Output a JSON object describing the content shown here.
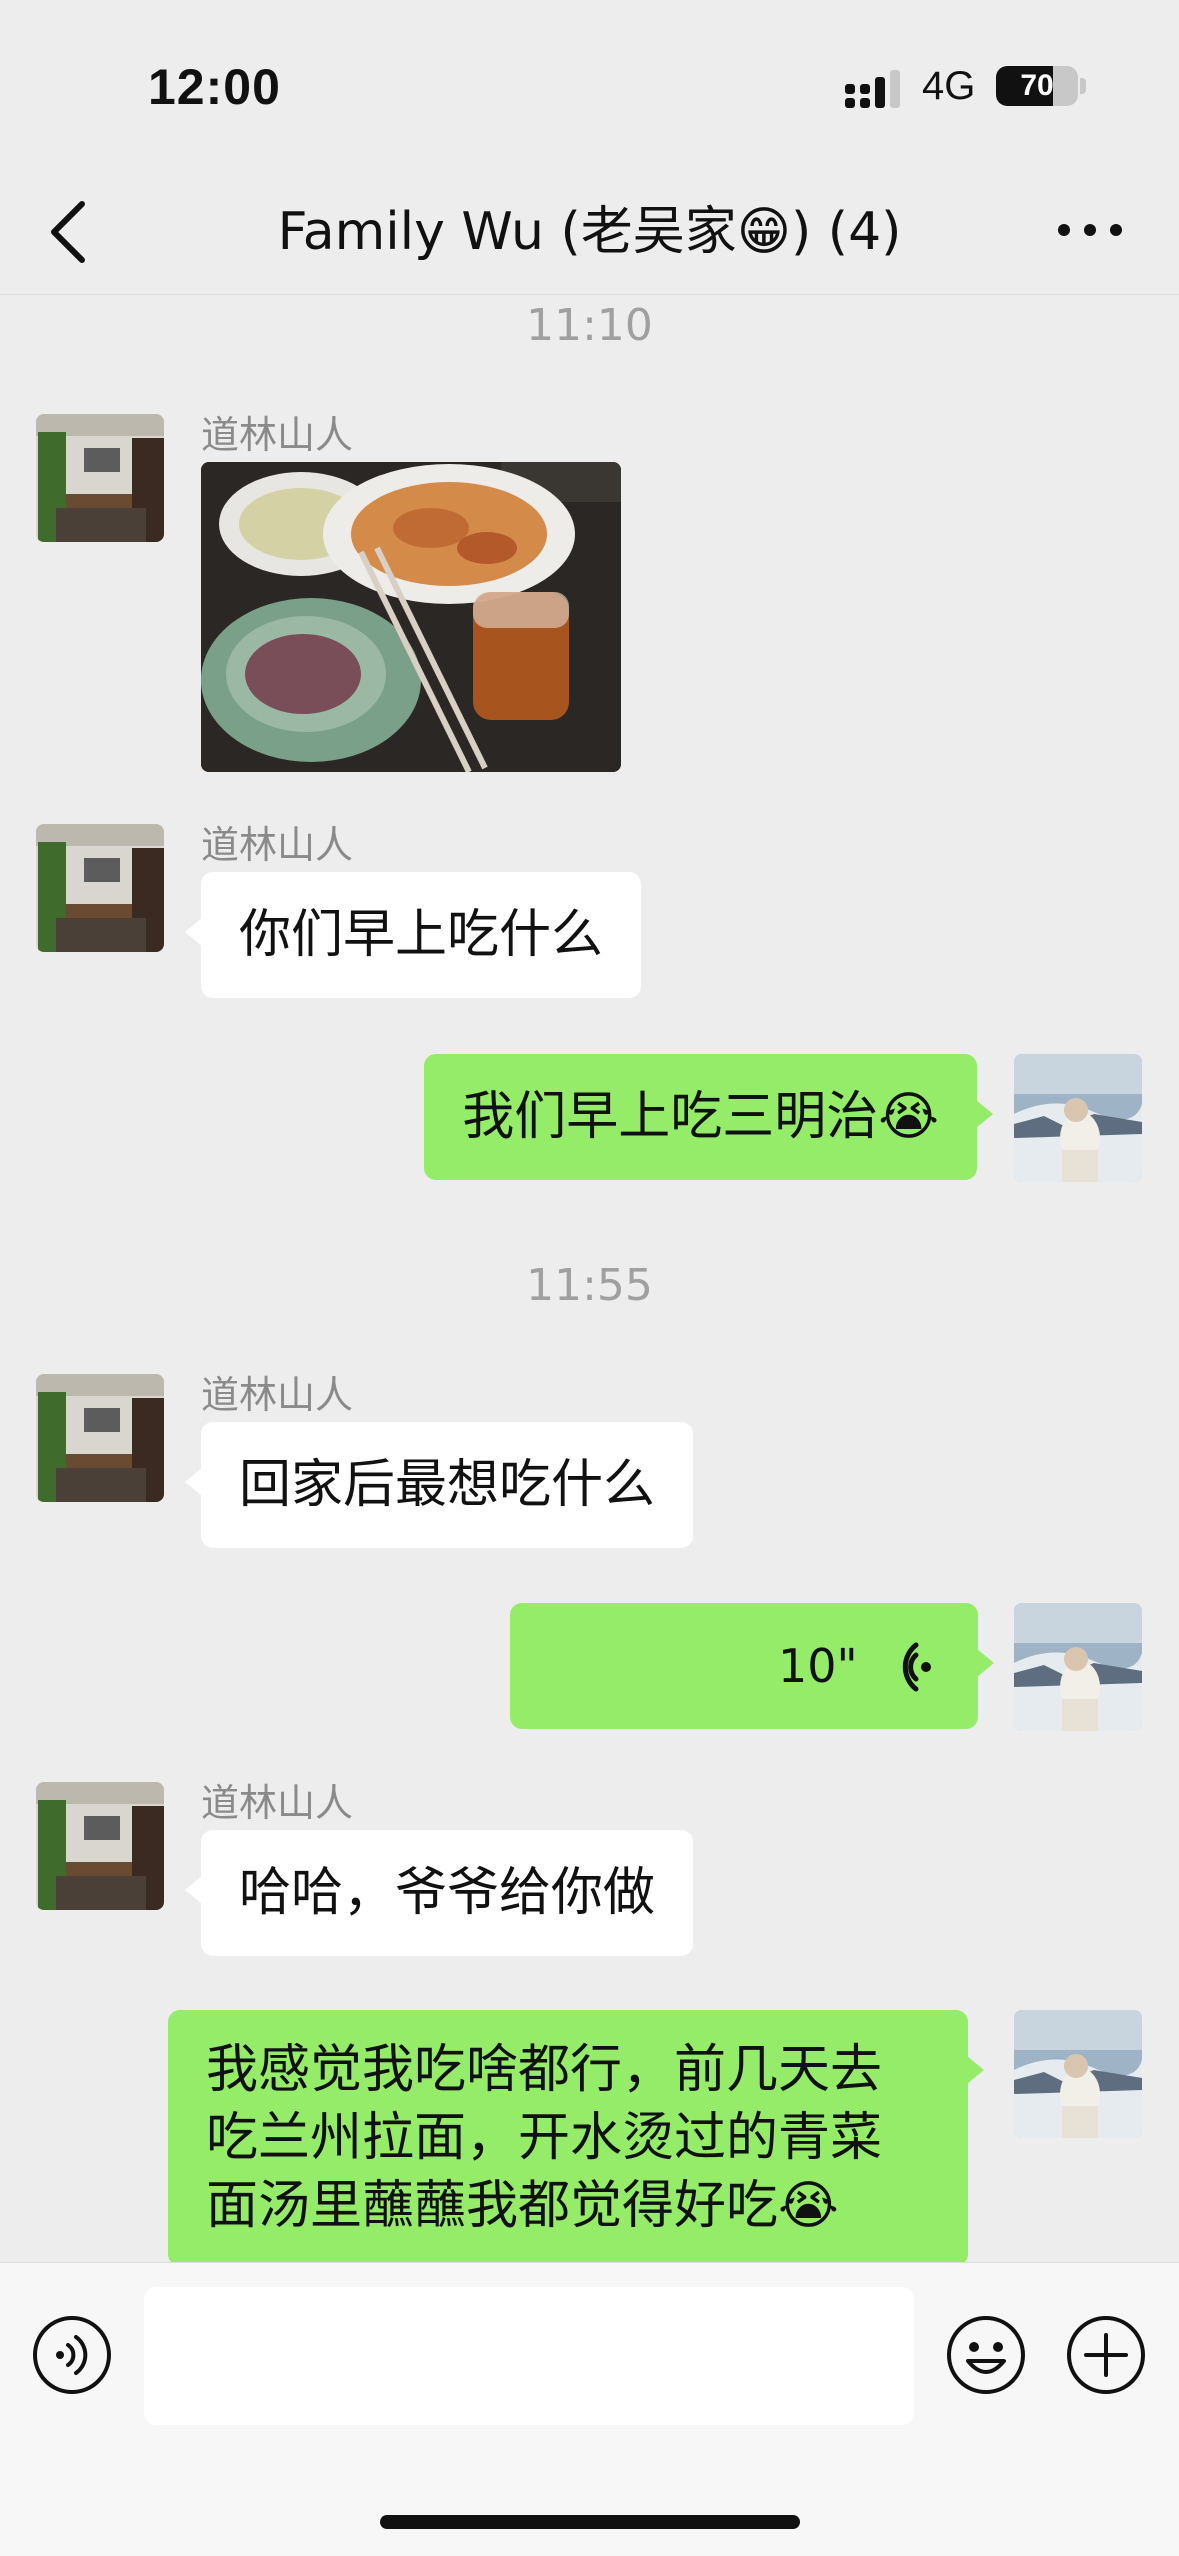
{
  "status_bar": {
    "time": "12:00",
    "network": "4G",
    "battery": "70"
  },
  "header": {
    "title": "Family Wu (老吴家😁) (4)"
  },
  "chat": {
    "timestamps": [
      "11:10",
      "11:55"
    ],
    "sender_name": "道林山人",
    "messages": {
      "m2": "你们早上吃什么",
      "m3": "我们早上吃三明治😭",
      "m4": "回家后最想吃什么",
      "m5_duration": "10\"",
      "m6": "哈哈，爷爷给你做",
      "m7": "我感觉我吃啥都行，前几天去吃兰州拉面，开水烫过的青菜面汤里蘸蘸我都觉得好吃😭"
    }
  },
  "input_bar": {
    "value": ""
  },
  "icons": [
    "chevron-left-icon",
    "more-icon",
    "voice-input-icon",
    "emoji-icon",
    "plus-icon",
    "voice-wave-icon"
  ],
  "colors": {
    "background": "#ededed",
    "outgoing_bubble": "#95ec69",
    "incoming_bubble": "#ffffff"
  }
}
